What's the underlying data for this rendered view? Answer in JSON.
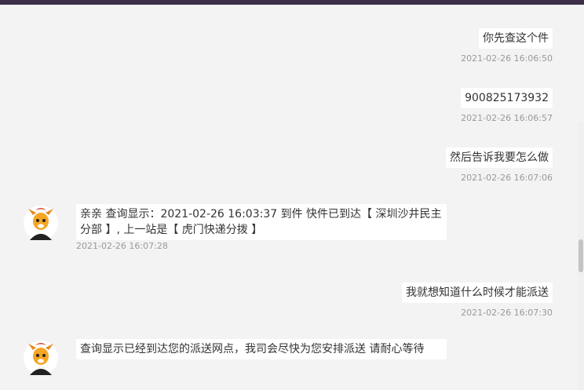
{
  "messages": [
    {
      "side": "right",
      "text": "你先查这个件",
      "time": "2021-02-26 16:06:50"
    },
    {
      "side": "right",
      "text": "900825173932",
      "time": "2021-02-26 16:06:57"
    },
    {
      "side": "right",
      "text": "然后告诉我要怎么做",
      "time": "2021-02-26 16:07:06"
    },
    {
      "side": "left",
      "text": "亲亲 查询显示：2021-02-26 16:03:37 到件 快件已到达【 深圳沙井民主分部 】, 上一站是【 虎门快递分拨 】",
      "time": "2021-02-26 16:07:28"
    },
    {
      "side": "right",
      "text": "我就想知道什么时候才能派送",
      "time": "2021-02-26 16:07:30"
    },
    {
      "side": "left",
      "text": "查询显示已经到达您的派送网点，我司会尽快为您安排派送 请耐心等待",
      "time": ""
    }
  ],
  "colors": {
    "topbar": "#3d2f4a",
    "background": "#f3f3f3",
    "bubble": "#ffffff",
    "timestamp": "#999999"
  }
}
